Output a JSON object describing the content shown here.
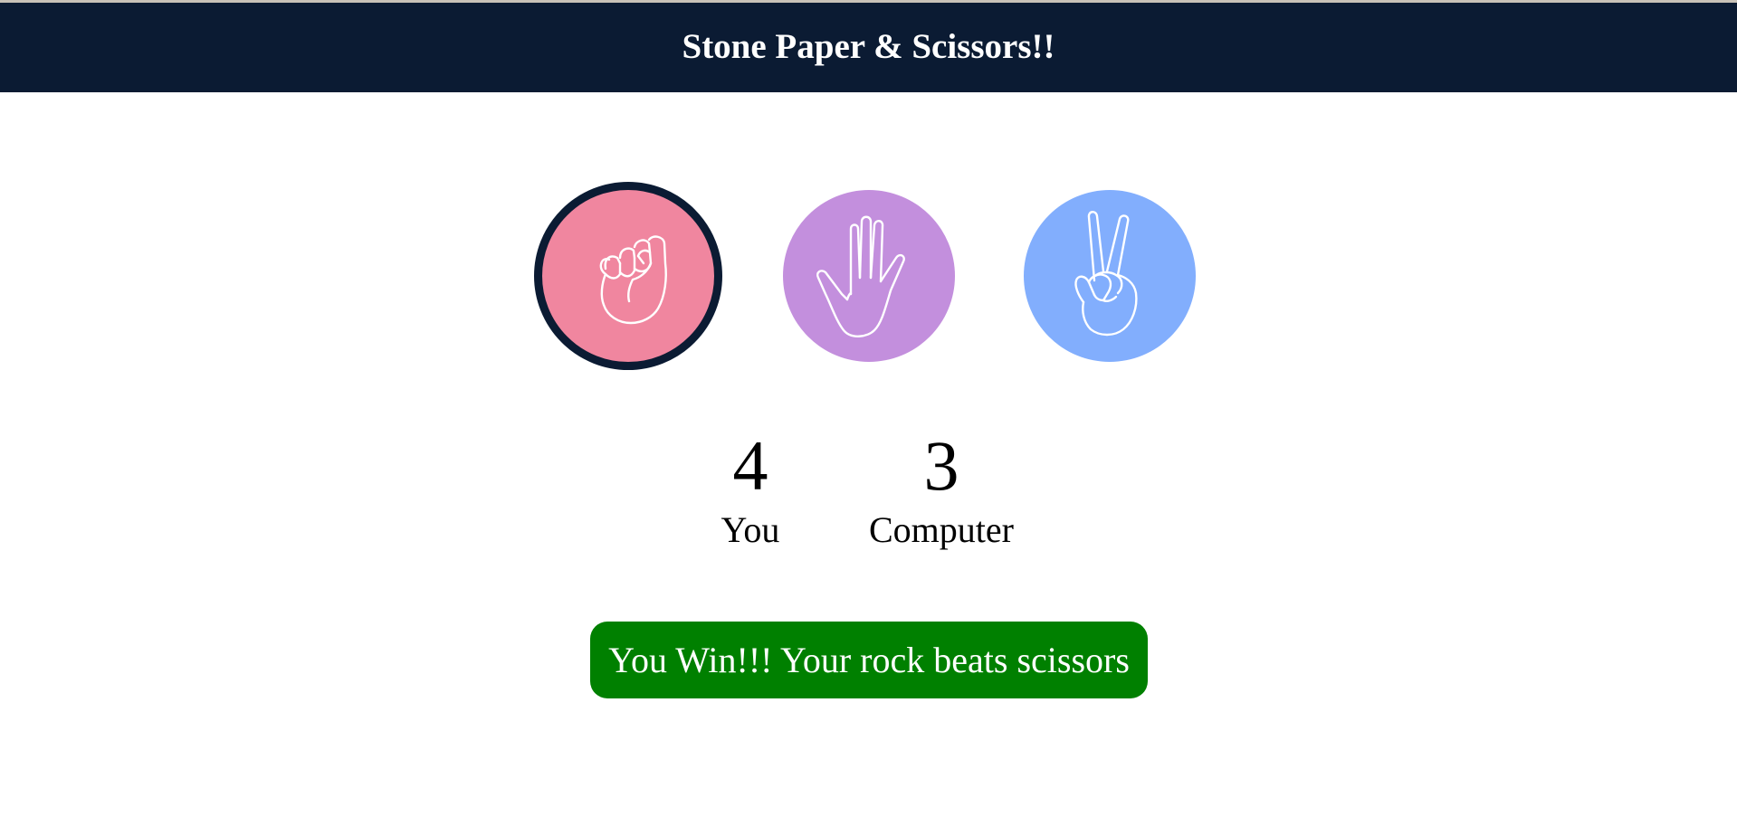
{
  "header": {
    "title": "Stone Paper & Scissors!!",
    "background": "#0b1b33"
  },
  "choices": [
    {
      "id": "rock",
      "icon": "fist-icon",
      "color": "#f0869f",
      "selected": true
    },
    {
      "id": "paper",
      "icon": "open-hand-icon",
      "color": "#c38fdd",
      "selected": false
    },
    {
      "id": "scissors",
      "icon": "peace-hand-icon",
      "color": "#82aefd",
      "selected": false
    }
  ],
  "scoreboard": {
    "user_score": "4",
    "user_label": "You",
    "computer_score": "3",
    "computer_label": "Computer"
  },
  "message": {
    "text": "You Win!!! Your rock beats scissors",
    "color": "#008000"
  }
}
